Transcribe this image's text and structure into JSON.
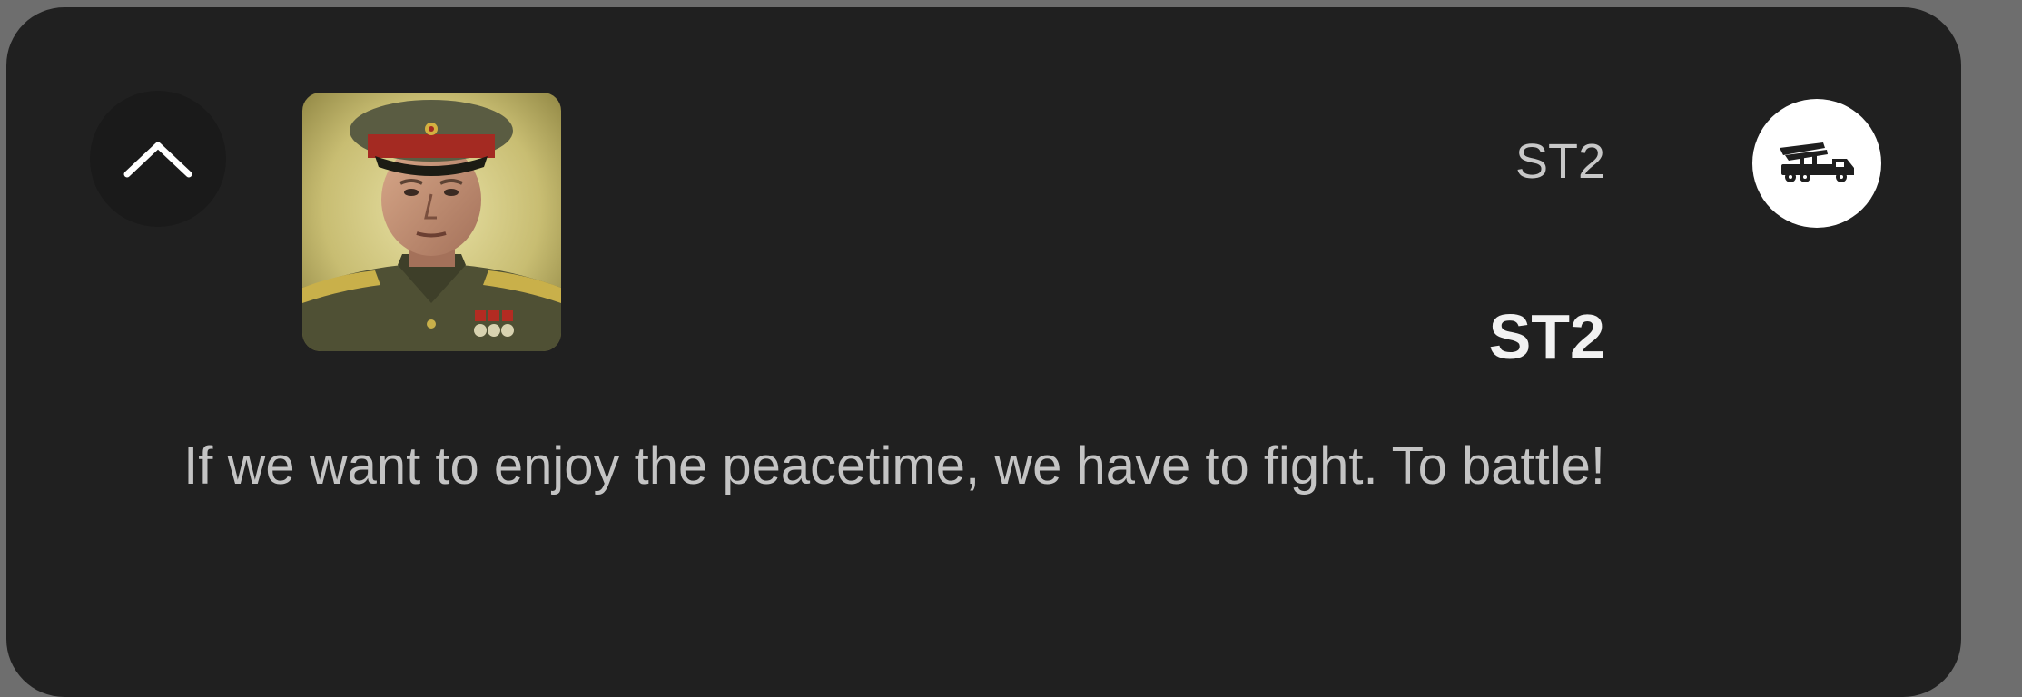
{
  "notification": {
    "app_name": "ST2",
    "title": "ST2",
    "message": "If we want to enjoy the peacetime, we have to fight. To battle!",
    "collapse_icon": "chevron-up-icon",
    "app_icon": "rocket-truck-icon",
    "avatar": "soldier-portrait"
  },
  "colors": {
    "card_background": "#202020",
    "page_background": "#6e6e6e",
    "title_text": "#f2f2f2",
    "body_text": "#c4c4c4"
  }
}
